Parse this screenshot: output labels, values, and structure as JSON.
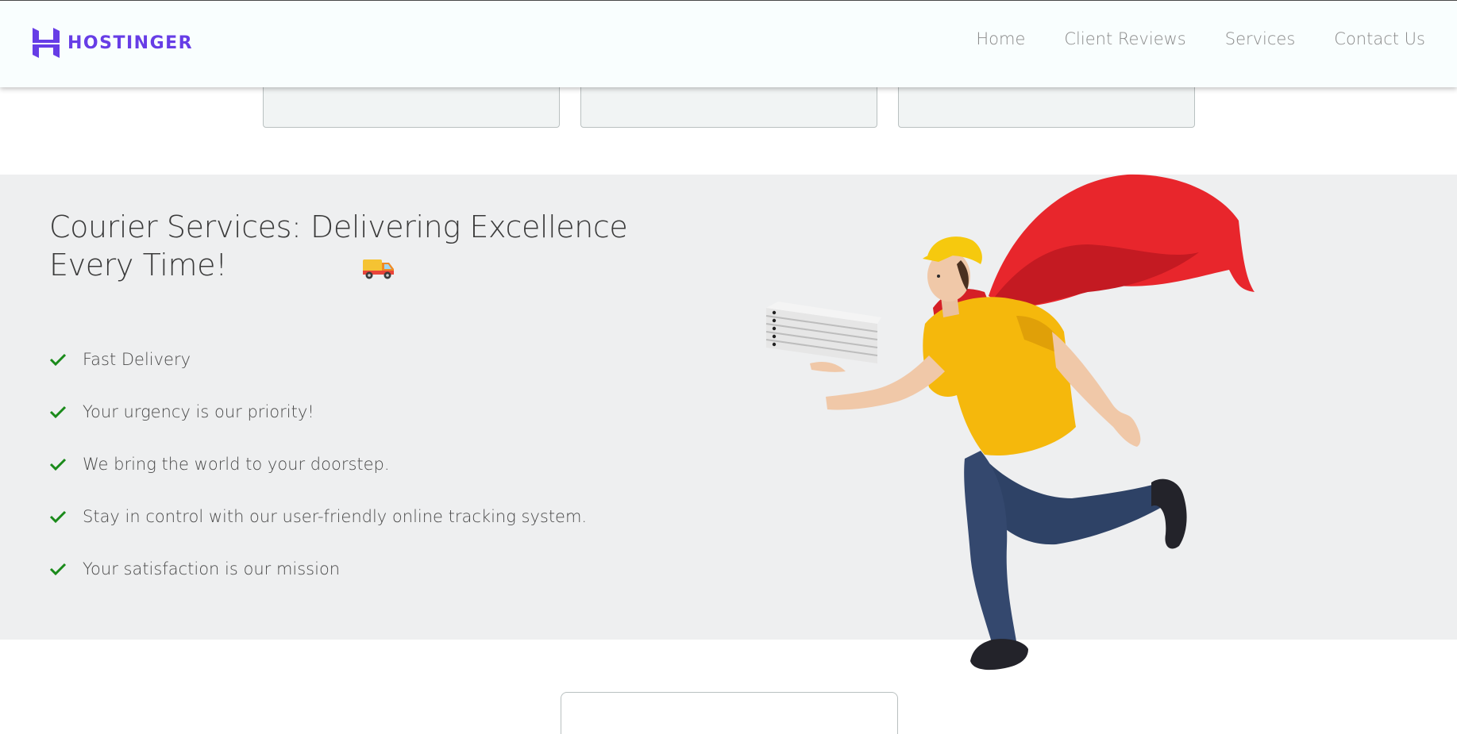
{
  "brand": {
    "name": "HOSTINGER",
    "logo_icon": "hostinger-h-logo",
    "color": "#673de6"
  },
  "nav": {
    "items": [
      {
        "label": "Home"
      },
      {
        "label": "Client Reviews"
      },
      {
        "label": "Services"
      },
      {
        "label": "Contact Us"
      }
    ]
  },
  "hero": {
    "title": "Courier Services: Delivering Excellence Every Time!",
    "title_icon": "delivery-truck-icon",
    "features": [
      {
        "icon": "check-icon",
        "text": "Fast Delivery"
      },
      {
        "icon": "check-icon",
        "text": "Your urgency is our priority!"
      },
      {
        "icon": "check-icon",
        "text": "We bring the world to your doorstep."
      },
      {
        "icon": "check-icon",
        "text": "Stay in control with our user-friendly online tracking system."
      },
      {
        "icon": "check-icon",
        "text": "Your satisfaction is our mission"
      }
    ],
    "check_color": "#1a8a1a",
    "background": "#eeeff0"
  }
}
